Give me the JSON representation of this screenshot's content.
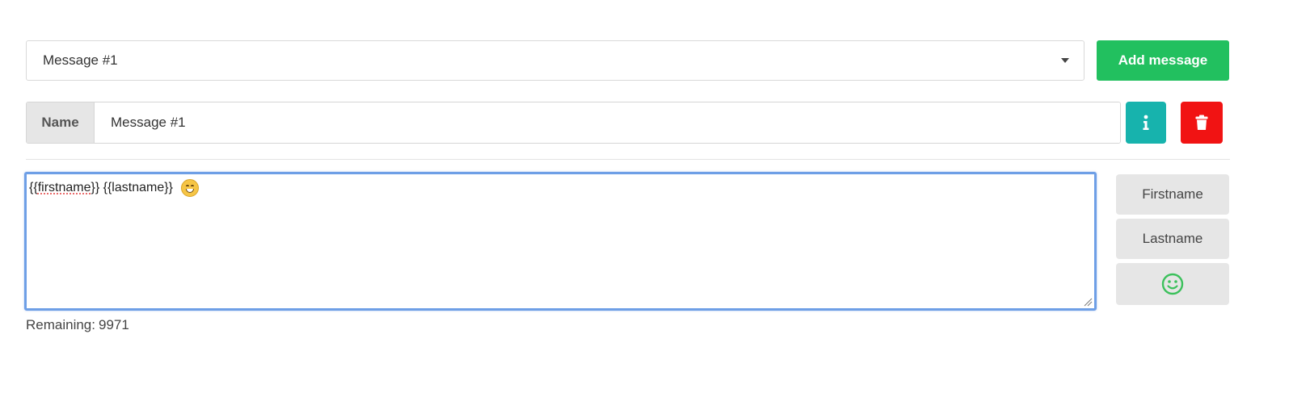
{
  "message_select": {
    "selected": "Message #1"
  },
  "add_message_label": "Add message",
  "name_group": {
    "label": "Name",
    "value": "Message #1"
  },
  "editor": {
    "text_parts": [
      "{{",
      "firstname",
      "}}",
      " {{lastname}}"
    ],
    "emoji": "grinning-face-emoji"
  },
  "remaining": {
    "label": "Remaining:",
    "value": "9971"
  },
  "side_buttons": {
    "firstname": "Firstname",
    "lastname": "Lastname",
    "emoji_icon": "smiley-icon"
  },
  "colors": {
    "add_button": "#22c05f",
    "info_button": "#17b3ad",
    "delete_button": "#f11313",
    "focus_border": "#6e9fe6",
    "smiley": "#3cc15c"
  }
}
